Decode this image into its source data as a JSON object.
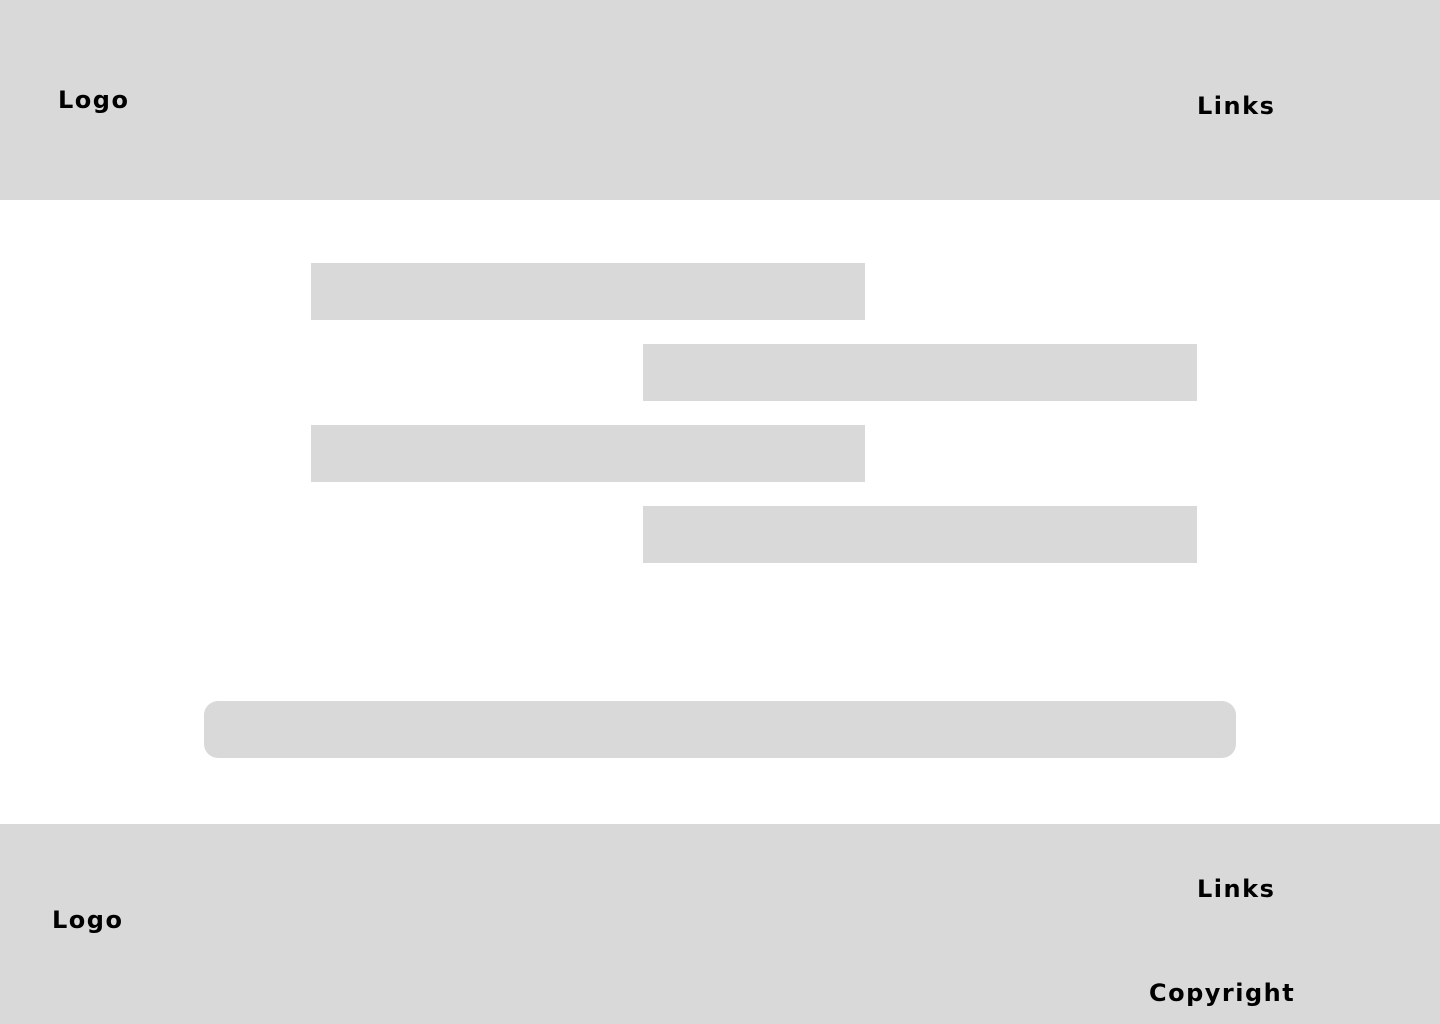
{
  "header": {
    "logo_text": "Logo",
    "links_text": "Links"
  },
  "chat": {
    "messages": [
      {
        "side": "left",
        "text": ""
      },
      {
        "side": "right",
        "text": ""
      },
      {
        "side": "left",
        "text": ""
      },
      {
        "side": "right",
        "text": ""
      }
    ],
    "input": {
      "value": "",
      "placeholder": ""
    }
  },
  "footer": {
    "logo_text": "Logo",
    "links_text": "Links",
    "copyright_text": "Copyright"
  },
  "colors": {
    "placeholder_gray": "#d9d9d9",
    "background": "#ffffff",
    "text": "#000000"
  }
}
